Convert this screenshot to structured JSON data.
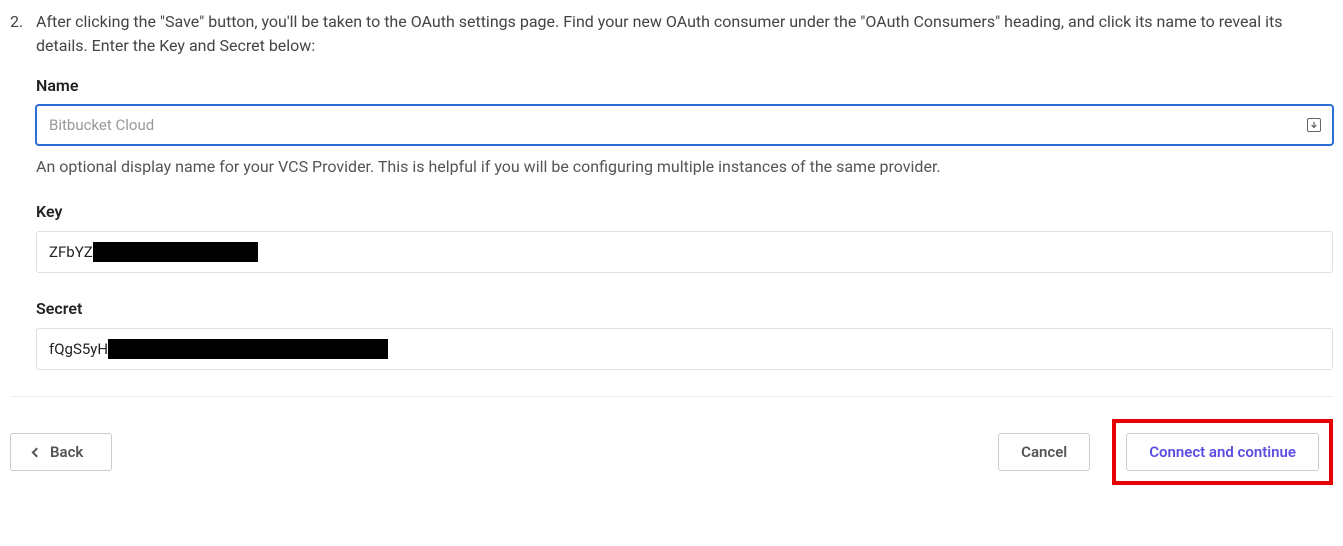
{
  "step": {
    "number": "2.",
    "text": "After clicking the \"Save\" button, you'll be taken to the OAuth settings page. Find your new OAuth consumer under the \"OAuth Consumers\" heading, and click its name to reveal its details. Enter the Key and Secret below:"
  },
  "name_field": {
    "label": "Name",
    "placeholder": "Bitbucket Cloud",
    "value": "",
    "help": "An optional display name for your VCS Provider. This is helpful if you will be configuring multiple instances of the same provider."
  },
  "key_field": {
    "label": "Key",
    "visible_value": "ZFbYZ"
  },
  "secret_field": {
    "label": "Secret",
    "visible_value": "fQgS5yH"
  },
  "buttons": {
    "back": "Back",
    "cancel": "Cancel",
    "connect": "Connect and continue"
  }
}
